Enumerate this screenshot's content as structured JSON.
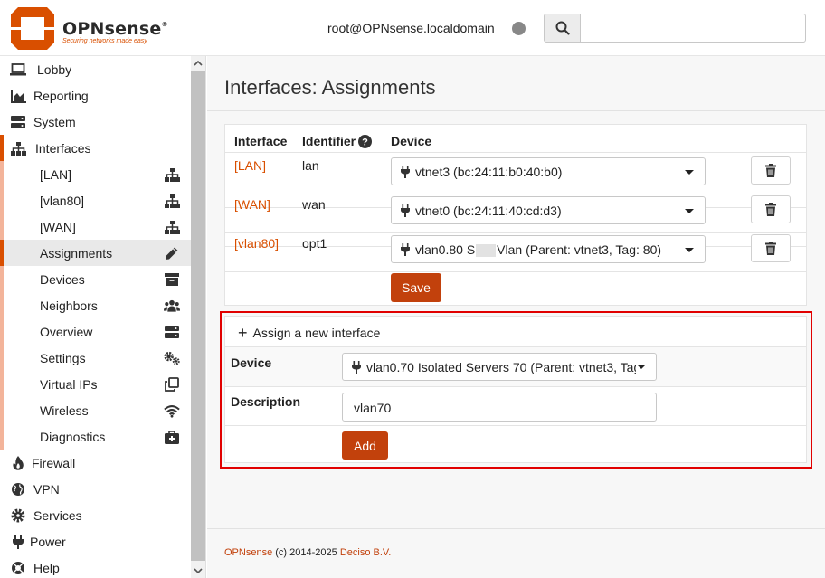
{
  "header": {
    "brand": "OPNsense",
    "brand_mark": "®",
    "tagline": "Securing networks made easy",
    "user": "root@OPNsense.localdomain",
    "search_placeholder": ""
  },
  "sidebar": {
    "items": [
      {
        "label": "Lobby",
        "icon": "laptop-icon"
      },
      {
        "label": "Reporting",
        "icon": "area-chart-icon"
      },
      {
        "label": "System",
        "icon": "server-icon"
      },
      {
        "label": "Interfaces",
        "icon": "sitemap-icon"
      }
    ],
    "interfaces_sub": [
      {
        "label": "[LAN]",
        "icon": "sitemap-icon"
      },
      {
        "label": "[vlan80]",
        "icon": "sitemap-icon"
      },
      {
        "label": "[WAN]",
        "icon": "sitemap-icon"
      },
      {
        "label": "Assignments",
        "icon": "pencil-icon"
      },
      {
        "label": "Devices",
        "icon": "archive-icon"
      },
      {
        "label": "Neighbors",
        "icon": "users-icon"
      },
      {
        "label": "Overview",
        "icon": "server-icon"
      },
      {
        "label": "Settings",
        "icon": "cogs-icon"
      },
      {
        "label": "Virtual IPs",
        "icon": "clone-icon"
      },
      {
        "label": "Wireless",
        "icon": "wifi-icon"
      },
      {
        "label": "Diagnostics",
        "icon": "medkit-icon"
      }
    ],
    "bottom_items": [
      {
        "label": "Firewall",
        "icon": "fire-icon"
      },
      {
        "label": "VPN",
        "icon": "globe-icon"
      },
      {
        "label": "Services",
        "icon": "cog-icon"
      },
      {
        "label": "Power",
        "icon": "plug-icon"
      },
      {
        "label": "Help",
        "icon": "help-icon"
      }
    ]
  },
  "main": {
    "title": "Interfaces: Assignments",
    "table": {
      "headers": {
        "interface": "Interface",
        "identifier": "Identifier",
        "device": "Device"
      },
      "rows": [
        {
          "interface": "[LAN]",
          "identifier": "lan",
          "device": "vtnet3 (bc:24:11:b0:40:b0)"
        },
        {
          "interface": "[WAN]",
          "identifier": "wan",
          "device": "vtnet0 (bc:24:11:40:cd:d3)"
        },
        {
          "interface": "[vlan80]",
          "identifier": "opt1",
          "device_prefix": "vlan0.80 S",
          "device_suffix": "Vlan (Parent: vtnet3, Tag: 80)"
        }
      ],
      "save_label": "Save"
    },
    "assign": {
      "title": "Assign a new interface",
      "device_label": "Device",
      "device_value": "vlan0.70 Isolated Servers 70 (Parent: vtnet3, Tag",
      "description_label": "Description",
      "description_value": "vlan70",
      "add_label": "Add"
    },
    "footer": {
      "brand_link": "OPNsense",
      "copyright": " (c) 2014-2025 ",
      "company_link": "Deciso B.V."
    }
  },
  "colors": {
    "accent": "#d94f00",
    "button": "#c2410c",
    "highlight": "#e10000"
  }
}
